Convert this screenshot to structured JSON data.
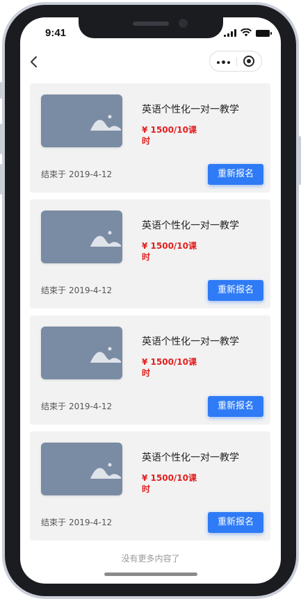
{
  "status_bar": {
    "time": "9:41",
    "icons": [
      "signal-icon",
      "wifi-icon",
      "battery-icon"
    ]
  },
  "nav": {
    "back_icon": "chevron-left-icon",
    "capsule_icons": [
      "more-dots-icon",
      "target-close-icon"
    ]
  },
  "courses": [
    {
      "title": "英语个性化一对一教学",
      "price": "¥ 1500/10课时",
      "ended_label": "结束于",
      "ended_date": "2019-4-12",
      "action": "重新报名",
      "image_icon": "image-placeholder-icon"
    },
    {
      "title": "英语个性化一对一教学",
      "price": "¥ 1500/10课时",
      "ended_label": "结束于",
      "ended_date": "2019-4-12",
      "action": "重新报名",
      "image_icon": "image-placeholder-icon"
    },
    {
      "title": "英语个性化一对一教学",
      "price": "¥ 1500/10课时",
      "ended_label": "结束于",
      "ended_date": "2019-4-12",
      "action": "重新报名",
      "image_icon": "image-placeholder-icon"
    },
    {
      "title": "英语个性化一对一教学",
      "price": "¥ 1500/10课时",
      "ended_label": "结束于",
      "ended_date": "2019-4-12",
      "action": "重新报名",
      "image_icon": "image-placeholder-icon"
    }
  ],
  "footer": {
    "no_more": "没有更多内容了"
  },
  "colors": {
    "primary_button": "#2f7bf5",
    "price": "#e02020",
    "card_bg": "#f2f2f2",
    "thumb_bg": "#7a8ca3"
  }
}
